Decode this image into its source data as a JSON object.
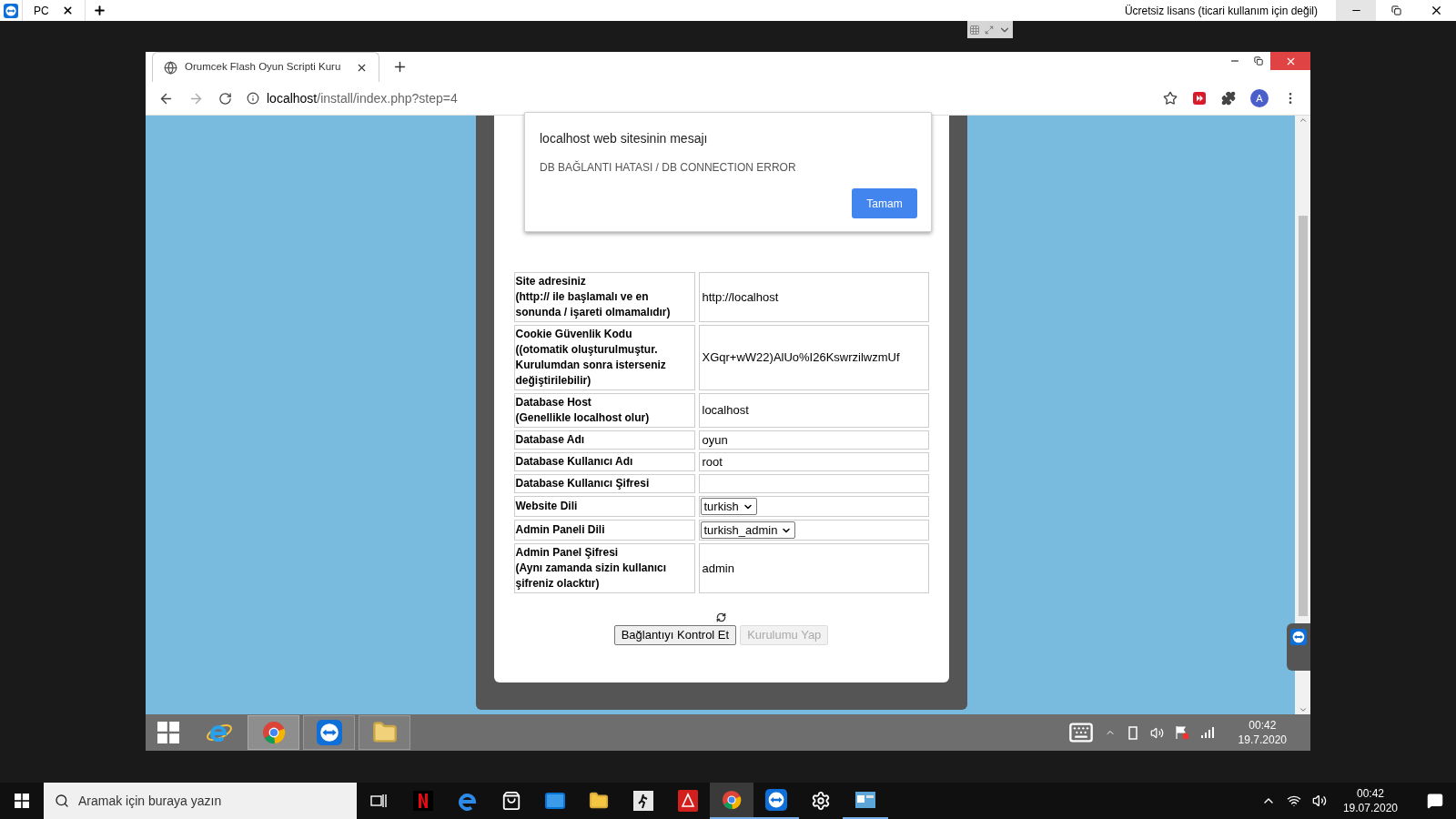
{
  "remote_app": {
    "tabs": [
      {
        "label": "PC",
        "selected": true
      }
    ],
    "license_notice": "Ücretsiz lisans (ticari kullanım için değil)"
  },
  "browser": {
    "tabs": [
      {
        "title": "Orumcek Flash Oyun Scripti Kuru",
        "selected": true
      }
    ],
    "url_host": "localhost",
    "url_path": "/install/index.php?step=4",
    "profile_initial": "A"
  },
  "alert": {
    "title": "localhost web sitesinin mesajı",
    "message": "DB BAĞLANTI HATASI / DB CONNECTION ERROR",
    "button": "Tamam"
  },
  "form": {
    "rows": [
      {
        "kind": "text",
        "label": "Site adresiniz",
        "note": "(http:// ile başlamalı ve en sonunda / işareti olmamalıdır)",
        "value": "http://localhost"
      },
      {
        "kind": "text",
        "label": "Cookie Güvenlik Kodu",
        "note": "((otomatik oluşturulmuştur. Kurulumdan sonra isterseniz değiştirilebilir)",
        "value": "XGqr+wW22)AlUo%I26KswrzilwzmUf"
      },
      {
        "kind": "text",
        "label": "Database Host",
        "note": "(Genellikle localhost olur)",
        "value": "localhost"
      },
      {
        "kind": "text",
        "label": "Database Adı",
        "value": "oyun"
      },
      {
        "kind": "text",
        "label": "Database Kullanıcı Adı",
        "value": "root"
      },
      {
        "kind": "text",
        "label": "Database Kullanıcı Şifresi"
      },
      {
        "kind": "select",
        "label": "Website Dili",
        "value": "turkish"
      },
      {
        "kind": "select",
        "label": "Admin Paneli Dili",
        "value": "turkish_admin"
      },
      {
        "kind": "text",
        "label": "Admin Panel Şifresi",
        "note": "(Aynı zamanda sizin kullanıcı şifreniz olacktır)",
        "value": "admin"
      }
    ]
  },
  "buttons": [
    {
      "label": "Bağlantıyı Kontrol Et",
      "disabled": false
    },
    {
      "label": "Kurulumu Yap",
      "disabled": true
    }
  ],
  "remote_taskbar": {
    "time": "00:42",
    "date": "19.7.2020"
  },
  "taskbar": {
    "search_placeholder": "Aramak için buraya yazın",
    "time": "00:42",
    "date": "19.07.2020"
  }
}
